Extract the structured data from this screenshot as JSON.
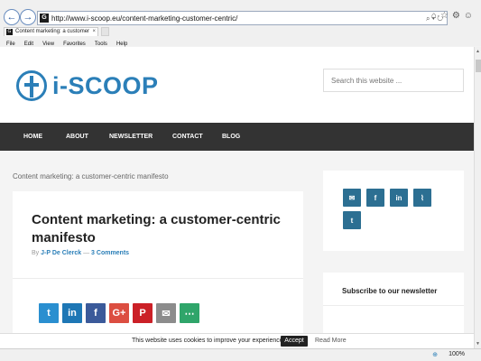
{
  "browser": {
    "url": "http://www.i-scoop.eu/content-marketing-customer-centric/",
    "favicon_letter": "G",
    "tab_title": "Content marketing: a customer-c...",
    "menu": [
      "File",
      "Edit",
      "View",
      "Favorites",
      "Tools",
      "Help"
    ],
    "zoom": "100%",
    "back_glyph": "←",
    "forward_glyph": "→",
    "addr_icons": "⌕ ▾ ↻",
    "tab_close": "×",
    "window_icons": "⌂☆⚙☺",
    "zoom_glyph": "⊕"
  },
  "site": {
    "brand": "i-SCOOP",
    "search_placeholder": "Search this website ...",
    "nav": [
      "HOME",
      "ABOUT",
      "NEWSLETTER",
      "CONTACT",
      "BLOG"
    ],
    "brand_color": "#2b7fb8"
  },
  "breadcrumb": "Content marketing: a customer-centric manifesto",
  "article": {
    "title": "Content marketing: a customer-centric manifesto",
    "by": "By",
    "author": "J-P De Clerck",
    "sep": "—",
    "comments": "3 Comments",
    "share_buttons": [
      {
        "icon": "twitter-icon",
        "glyph": "t",
        "color": "#2a8fd0"
      },
      {
        "icon": "linkedin-icon",
        "glyph": "in",
        "color": "#1e77b5"
      },
      {
        "icon": "facebook-icon",
        "glyph": "f",
        "color": "#3b5a9a"
      },
      {
        "icon": "google-plus-icon",
        "glyph": "G+",
        "color": "#dc4e41"
      },
      {
        "icon": "pinterest-icon",
        "glyph": "P",
        "color": "#cb2027"
      },
      {
        "icon": "email-icon",
        "glyph": "✉",
        "color": "#8c8c8c"
      },
      {
        "icon": "more-share-icon",
        "glyph": "⋯",
        "color": "#2fa56a"
      }
    ]
  },
  "sidebar": {
    "social": [
      {
        "icon": "email-icon",
        "glyph": "✉"
      },
      {
        "icon": "facebook-icon",
        "glyph": "f"
      },
      {
        "icon": "linkedin-icon",
        "glyph": "in"
      },
      {
        "icon": "rss-icon",
        "glyph": "⌇"
      },
      {
        "icon": "twitter-icon",
        "glyph": "t"
      }
    ],
    "newsletter_title": "Subscribe to our newsletter"
  },
  "cookie": {
    "text": "This website uses cookies to improve your experience.",
    "accept": "Accept",
    "read_more": "Read More"
  }
}
